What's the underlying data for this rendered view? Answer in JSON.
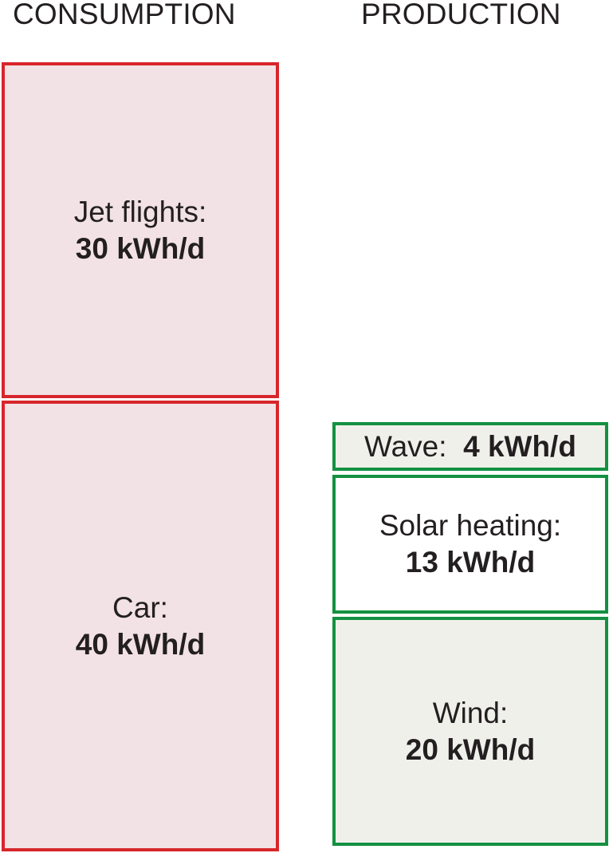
{
  "headers": {
    "consumption": "CONSUMPTION",
    "production": "PRODUCTION"
  },
  "chart_data": {
    "type": "bar",
    "stacked": true,
    "unit": "kWh/d",
    "categories": [
      "CONSUMPTION",
      "PRODUCTION"
    ],
    "series": [
      {
        "column": "CONSUMPTION",
        "items": [
          {
            "label": "Car:",
            "value": 40,
            "value_text": "40 kWh/d",
            "color": "#d7262b"
          },
          {
            "label": "Jet flights:",
            "value": 30,
            "value_text": "30 kWh/d",
            "color": "#d7262b"
          }
        ]
      },
      {
        "column": "PRODUCTION",
        "items": [
          {
            "label": "Wind:",
            "value": 20,
            "value_text": "20 kWh/d",
            "color": "#139141"
          },
          {
            "label": "Solar heating:",
            "value": 13,
            "value_text": "13 kWh/d",
            "color": "#139141"
          },
          {
            "label": "Wave:",
            "value": 4,
            "value_text": "4 kWh/d",
            "color": "#139141"
          }
        ]
      }
    ],
    "colors": {
      "consumption_border": "#d7262b",
      "consumption_fill": "#f2e2e5",
      "production_border": "#139141",
      "production_fill": "#f0f0eb"
    }
  }
}
